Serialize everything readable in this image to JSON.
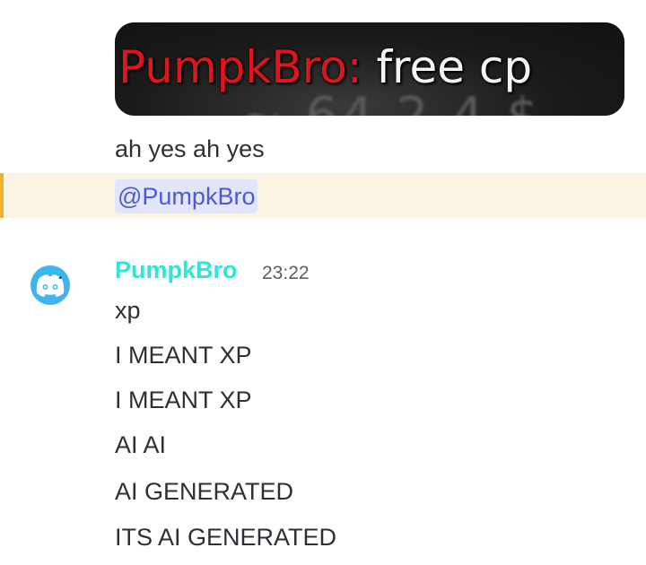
{
  "embed": {
    "overlay_name": "PumpkBro:",
    "overlay_message": " free cp"
  },
  "messages_before": {
    "line1": "ah yes ah yes",
    "mention": "@PumpkBro"
  },
  "group": {
    "author": "PumpkBro",
    "timestamp": "23:22",
    "avatar_icon": "discord-logo-icon",
    "author_color": "#2ee6d8",
    "lines": [
      "xp",
      "I MEANT XP",
      "I MEANT XP",
      "AI AI",
      "AI GENERATED",
      "ITS AI GENERATED"
    ]
  },
  "colors": {
    "mention_highlight_bg": "#fbf3e3",
    "mention_bar": "#f0b232",
    "mention_text": "#4c5bd4",
    "mention_pill_bg": "#e3e5fb",
    "avatar_bg": "#3fb5f0"
  }
}
